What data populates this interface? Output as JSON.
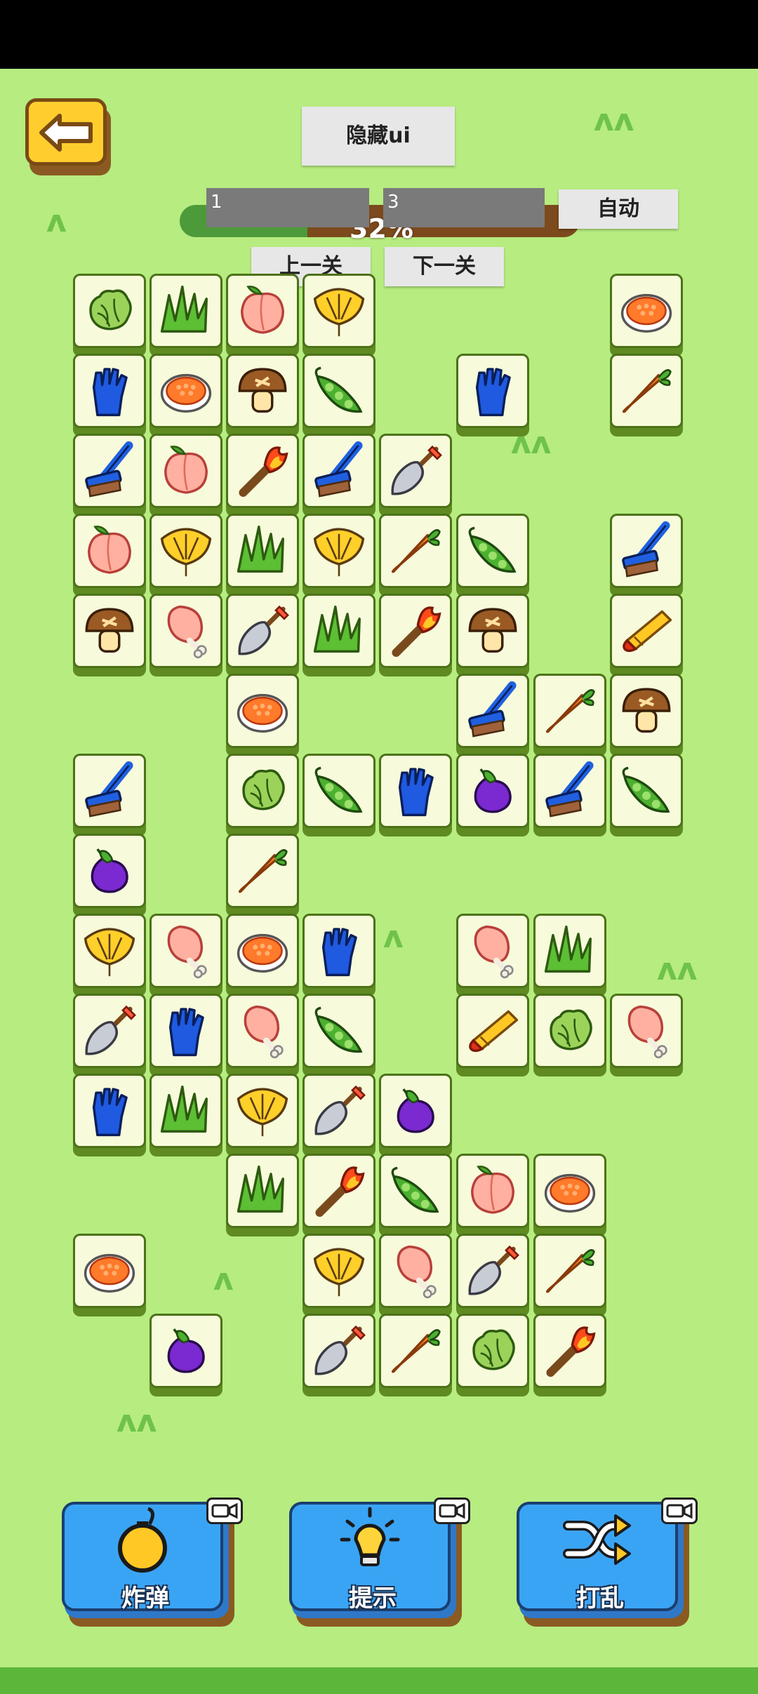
{
  "toolbar": {
    "hide_ui_label": "隐藏ui",
    "auto_label": "自动",
    "prev_level_label": "上一关",
    "next_level_label": "下一关",
    "field_left_value": "1",
    "field_right_value": "3"
  },
  "progress": {
    "value_percent": 32,
    "label": "32%"
  },
  "board": {
    "tiles": [
      {
        "icon": "cabbage",
        "col": 0,
        "row": 0
      },
      {
        "icon": "grass",
        "col": 1,
        "row": 0
      },
      {
        "icon": "peach",
        "col": 2,
        "row": 0
      },
      {
        "icon": "ginkgo",
        "col": 3,
        "row": 0
      },
      {
        "icon": "roe-bowl",
        "col": 7,
        "row": 0
      },
      {
        "icon": "glove",
        "col": 0,
        "row": 1
      },
      {
        "icon": "roe-bowl",
        "col": 1,
        "row": 1
      },
      {
        "icon": "mushroom",
        "col": 2,
        "row": 1
      },
      {
        "icon": "pea-pod",
        "col": 3,
        "row": 1
      },
      {
        "icon": "glove",
        "col": 5,
        "row": 1
      },
      {
        "icon": "carrot",
        "col": 7,
        "row": 1
      },
      {
        "icon": "brush",
        "col": 0,
        "row": 2
      },
      {
        "icon": "peach",
        "col": 1,
        "row": 2
      },
      {
        "icon": "torch",
        "col": 2,
        "row": 2
      },
      {
        "icon": "brush",
        "col": 3,
        "row": 2
      },
      {
        "icon": "shovel",
        "col": 4,
        "row": 2
      },
      {
        "icon": "peach",
        "col": 0,
        "row": 3
      },
      {
        "icon": "ginkgo",
        "col": 1,
        "row": 3
      },
      {
        "icon": "grass",
        "col": 2,
        "row": 3
      },
      {
        "icon": "ginkgo",
        "col": 3,
        "row": 3
      },
      {
        "icon": "carrot",
        "col": 4,
        "row": 3
      },
      {
        "icon": "pea-pod",
        "col": 5,
        "row": 3
      },
      {
        "icon": "brush",
        "col": 7,
        "row": 3
      },
      {
        "icon": "mushroom",
        "col": 0,
        "row": 4
      },
      {
        "icon": "drumstick",
        "col": 1,
        "row": 4
      },
      {
        "icon": "shovel",
        "col": 2,
        "row": 4
      },
      {
        "icon": "grass",
        "col": 3,
        "row": 4
      },
      {
        "icon": "torch",
        "col": 4,
        "row": 4
      },
      {
        "icon": "mushroom",
        "col": 5,
        "row": 4
      },
      {
        "icon": "crayon",
        "col": 7,
        "row": 4
      },
      {
        "icon": "roe-bowl",
        "col": 2,
        "row": 5
      },
      {
        "icon": "brush",
        "col": 5,
        "row": 5
      },
      {
        "icon": "carrot",
        "col": 6,
        "row": 5
      },
      {
        "icon": "mushroom",
        "col": 7,
        "row": 5
      },
      {
        "icon": "brush",
        "col": 0,
        "row": 6
      },
      {
        "icon": "cabbage",
        "col": 2,
        "row": 6
      },
      {
        "icon": "pea-pod",
        "col": 3,
        "row": 6
      },
      {
        "icon": "glove",
        "col": 4,
        "row": 6
      },
      {
        "icon": "eggplant",
        "col": 5,
        "row": 6
      },
      {
        "icon": "brush",
        "col": 6,
        "row": 6
      },
      {
        "icon": "pea-pod",
        "col": 7,
        "row": 6
      },
      {
        "icon": "eggplant",
        "col": 0,
        "row": 7
      },
      {
        "icon": "carrot",
        "col": 2,
        "row": 7
      },
      {
        "icon": "ginkgo",
        "col": 0,
        "row": 8
      },
      {
        "icon": "drumstick",
        "col": 1,
        "row": 8
      },
      {
        "icon": "roe-bowl",
        "col": 2,
        "row": 8
      },
      {
        "icon": "glove",
        "col": 3,
        "row": 8
      },
      {
        "icon": "drumstick",
        "col": 5,
        "row": 8
      },
      {
        "icon": "grass",
        "col": 6,
        "row": 8
      },
      {
        "icon": "shovel",
        "col": 0,
        "row": 9
      },
      {
        "icon": "glove",
        "col": 1,
        "row": 9
      },
      {
        "icon": "drumstick",
        "col": 2,
        "row": 9
      },
      {
        "icon": "pea-pod",
        "col": 3,
        "row": 9
      },
      {
        "icon": "crayon",
        "col": 5,
        "row": 9
      },
      {
        "icon": "cabbage",
        "col": 6,
        "row": 9
      },
      {
        "icon": "drumstick",
        "col": 7,
        "row": 9
      },
      {
        "icon": "glove",
        "col": 0,
        "row": 10
      },
      {
        "icon": "grass",
        "col": 1,
        "row": 10
      },
      {
        "icon": "ginkgo",
        "col": 2,
        "row": 10
      },
      {
        "icon": "shovel",
        "col": 3,
        "row": 10
      },
      {
        "icon": "eggplant",
        "col": 4,
        "row": 10
      },
      {
        "icon": "grass",
        "col": 2,
        "row": 11
      },
      {
        "icon": "torch",
        "col": 3,
        "row": 11
      },
      {
        "icon": "pea-pod",
        "col": 4,
        "row": 11
      },
      {
        "icon": "peach",
        "col": 5,
        "row": 11
      },
      {
        "icon": "roe-bowl",
        "col": 6,
        "row": 11
      },
      {
        "icon": "roe-bowl",
        "col": 0,
        "row": 12
      },
      {
        "icon": "ginkgo",
        "col": 3,
        "row": 12
      },
      {
        "icon": "drumstick",
        "col": 4,
        "row": 12
      },
      {
        "icon": "shovel",
        "col": 5,
        "row": 12
      },
      {
        "icon": "carrot",
        "col": 6,
        "row": 12
      },
      {
        "icon": "eggplant",
        "col": 1,
        "row": 13
      },
      {
        "icon": "shovel",
        "col": 3,
        "row": 13
      },
      {
        "icon": "carrot",
        "col": 4,
        "row": 13
      },
      {
        "icon": "cabbage",
        "col": 5,
        "row": 13
      },
      {
        "icon": "torch",
        "col": 6,
        "row": 13
      }
    ]
  },
  "powerups": [
    {
      "label": "炸弹",
      "icon": "bomb-icon",
      "ad_icon": "video-ad-icon"
    },
    {
      "label": "提示",
      "icon": "lightbulb-icon",
      "ad_icon": "video-ad-icon"
    },
    {
      "label": "打乱",
      "icon": "shuffle-icon",
      "ad_icon": "video-ad-icon"
    }
  ]
}
